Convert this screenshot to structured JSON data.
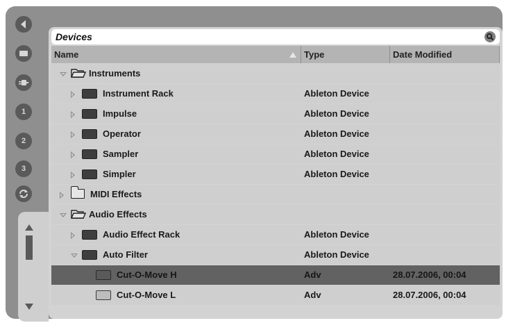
{
  "browser": {
    "title": "Devices",
    "columns": {
      "name": "Name",
      "type": "Type",
      "date": "Date Modified"
    }
  },
  "sidebar": {
    "buttons": [
      {
        "icon": "back-arrow-icon"
      },
      {
        "icon": "device-browser-icon"
      },
      {
        "icon": "plugin-browser-icon"
      },
      {
        "icon": "file-browser-1-icon",
        "label": "1"
      },
      {
        "icon": "file-browser-2-icon",
        "label": "2"
      },
      {
        "icon": "file-browser-3-icon",
        "label": "3"
      },
      {
        "icon": "refresh-icon"
      }
    ]
  },
  "rows": [
    {
      "label": "Instruments",
      "type": "",
      "date": ""
    },
    {
      "label": "Instrument Rack",
      "type": "Ableton Device",
      "date": ""
    },
    {
      "label": "Impulse",
      "type": "Ableton Device",
      "date": ""
    },
    {
      "label": "Operator",
      "type": "Ableton Device",
      "date": ""
    },
    {
      "label": "Sampler",
      "type": "Ableton Device",
      "date": ""
    },
    {
      "label": "Simpler",
      "type": "Ableton Device",
      "date": ""
    },
    {
      "label": "MIDI Effects",
      "type": "",
      "date": ""
    },
    {
      "label": "Audio Effects",
      "type": "",
      "date": ""
    },
    {
      "label": "Audio Effect Rack",
      "type": "Ableton Device",
      "date": ""
    },
    {
      "label": "Auto Filter",
      "type": "Ableton Device",
      "date": ""
    },
    {
      "label": "Cut-O-Move H",
      "type": "Adv",
      "date": "28.07.2006, 00:04"
    },
    {
      "label": "Cut-O-Move L",
      "type": "Adv",
      "date": "28.07.2006, 00:04"
    }
  ],
  "colors": {
    "frame": "#8f8f8f",
    "row": "#cfcfcf",
    "selected_row": "#626262",
    "header": "#b4b4b4"
  }
}
